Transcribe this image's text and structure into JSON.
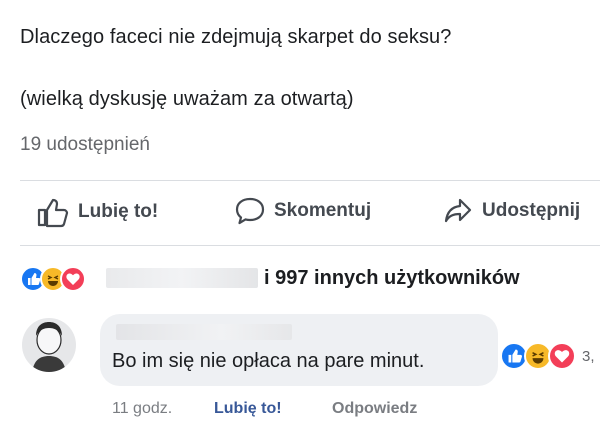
{
  "post": {
    "line1": "Dlaczego faceci nie zdejmują skarpet do seksu?",
    "line2": "(wielką dyskusję uważam za otwartą)",
    "shares": "19 udostępnień"
  },
  "actions": {
    "like": {
      "label": "Lubię to!",
      "icon": "thumbs-up-icon"
    },
    "comment": {
      "label": "Skomentuj",
      "icon": "speech-bubble-icon"
    },
    "share": {
      "label": "Udostępnij",
      "icon": "share-arrow-icon"
    }
  },
  "reactions": {
    "icons": [
      "like-reaction-icon",
      "haha-reaction-icon",
      "love-reaction-icon"
    ],
    "colors": {
      "like": "#1877f2",
      "haha": "#f7b928",
      "love": "#f33e58"
    },
    "summary": "i 997 innych użytkowników"
  },
  "comment": {
    "text": "Bo im się nie opłaca na pare minut.",
    "reaction_count": "3,",
    "time": "11 godz.",
    "like_label": "Lubię to!",
    "reply_label": "Odpowiedz"
  }
}
